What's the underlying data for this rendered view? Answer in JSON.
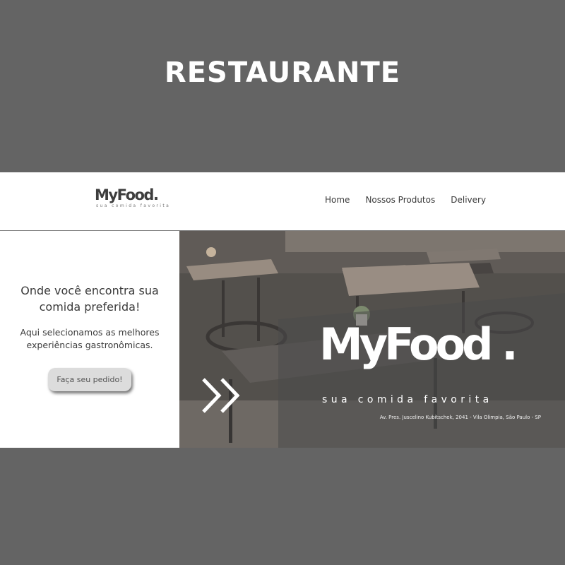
{
  "page": {
    "heading": "RESTAURANTE",
    "background_color": "#646464"
  },
  "navbar": {
    "logo_text": "MyFood.",
    "logo_tagline": "sua comida favorita",
    "links": [
      "Home",
      "Nossos Produtos",
      "Delivery"
    ]
  },
  "intro": {
    "headline": "Onde você encontra sua comida preferida!",
    "subline": "Aqui selecionamos as melhores experiências gastronômicas.",
    "cta_label": "Faça seu pedido!"
  },
  "hero": {
    "logo_text": "MyFood .",
    "tagline": "sua comida favorita",
    "address": "Av. Pres. Juscelino Kubitschek, 2041 - Vila Olimpia, São Paulo - SP",
    "photo_icon": "restaurant-interior-photo",
    "arrow_icon": "double-chevron-right-icon"
  }
}
